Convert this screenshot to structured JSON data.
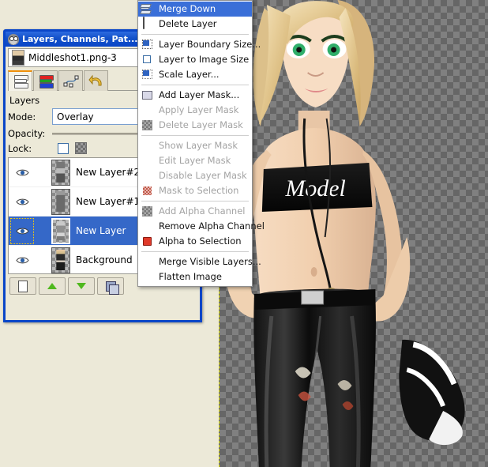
{
  "dialog": {
    "title": "Layers, Channels, Pat...",
    "titlebar_icon": "wilber-icon",
    "image_name": "Middleshot1.png-3",
    "tabs": [
      {
        "name": "tab-layers",
        "icon": "layers-stack-icon",
        "active": true
      },
      {
        "name": "tab-channels",
        "icon": "channels-icon",
        "active": false
      },
      {
        "name": "tab-paths",
        "icon": "paths-icon",
        "active": false
      },
      {
        "name": "tab-undo-history",
        "icon": "undo-history-icon",
        "active": false
      }
    ],
    "section_label": "Layers",
    "mode_label": "Mode:",
    "mode_value": "Overlay",
    "opacity_label": "Opacity:",
    "lock_label": "Lock:",
    "layers": [
      {
        "name": "New Layer#2",
        "visible": true,
        "selected": false
      },
      {
        "name": "New Layer#1",
        "visible": true,
        "selected": false
      },
      {
        "name": "New Layer",
        "visible": true,
        "selected": true
      },
      {
        "name": "Background",
        "visible": true,
        "selected": false
      }
    ],
    "buttons": [
      {
        "name": "new-layer-button",
        "icon": "page-icon"
      },
      {
        "name": "raise-layer-button",
        "icon": "arrow-up-icon"
      },
      {
        "name": "lower-layer-button",
        "icon": "arrow-down-icon"
      },
      {
        "name": "duplicate-layer-button",
        "icon": "duplicate-icon"
      }
    ]
  },
  "context_menu": {
    "items": [
      {
        "label": "Merge Down",
        "icon": "merge-down-icon",
        "state": "highlight"
      },
      {
        "label": "Delete Layer",
        "icon": "trash-icon",
        "state": "enabled"
      },
      {
        "separator": true
      },
      {
        "label": "Layer Boundary Size...",
        "icon": "layer-boundary-icon",
        "state": "enabled"
      },
      {
        "label": "Layer to Image Size",
        "icon": "layer-to-image-icon",
        "state": "enabled"
      },
      {
        "label": "Scale Layer...",
        "icon": "scale-layer-icon",
        "state": "enabled"
      },
      {
        "separator": true
      },
      {
        "label": "Add Layer Mask...",
        "icon": "add-layer-mask-icon",
        "state": "enabled"
      },
      {
        "label": "Apply Layer Mask",
        "icon": "none",
        "state": "disabled"
      },
      {
        "label": "Delete Layer Mask",
        "icon": "delete-mask-icon",
        "state": "disabled"
      },
      {
        "separator": true
      },
      {
        "label": "Show Layer Mask",
        "icon": "none",
        "state": "disabled"
      },
      {
        "label": "Edit Layer Mask",
        "icon": "none",
        "state": "disabled"
      },
      {
        "label": "Disable Layer Mask",
        "icon": "none",
        "state": "disabled"
      },
      {
        "label": "Mask to Selection",
        "icon": "mask-to-selection-icon",
        "state": "disabled"
      },
      {
        "separator": true
      },
      {
        "label": "Add Alpha Channel",
        "icon": "alpha-channel-icon",
        "state": "disabled"
      },
      {
        "label": "Remove Alpha Channel",
        "icon": "none",
        "state": "enabled"
      },
      {
        "label": "Alpha to Selection",
        "icon": "alpha-to-selection-icon",
        "state": "enabled"
      },
      {
        "separator": true
      },
      {
        "label": "Merge Visible Layers...",
        "icon": "none",
        "state": "enabled"
      },
      {
        "label": "Flatten Image",
        "icon": "none",
        "state": "enabled"
      }
    ]
  },
  "canvas": {
    "name": "image-canvas",
    "checker_light": "#808080",
    "checker_dark": "#666666",
    "boundary_color": "#e8e800"
  },
  "colors": {
    "desktop": "#ece9d8",
    "title_blue": "#0a46c8",
    "selection_blue": "#3568c8",
    "menu_highlight": "#3a6fd8"
  }
}
